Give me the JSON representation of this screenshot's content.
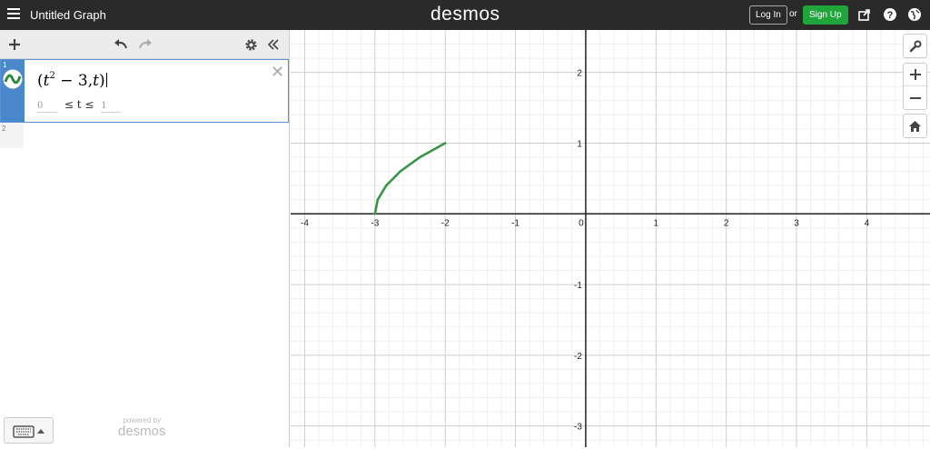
{
  "app": {
    "title": "Untitled Graph",
    "brand": "desmos",
    "login": "Log In",
    "or": "or",
    "signup": "Sign Up",
    "icons": [
      "menu-icon",
      "share-icon",
      "help-icon",
      "globe-icon"
    ]
  },
  "expressions": {
    "toolbar_icons": [
      "add-icon",
      "undo-icon",
      "redo-icon",
      "settings-icon",
      "collapse-icon"
    ],
    "items": [
      {
        "number": "1",
        "base": "t",
        "exponent": "2",
        "rest": " − 3,",
        "param": "t",
        "domain_min": "0",
        "domain_mid": "≤ t ≤",
        "domain_max": "1",
        "color": "#2d8b3a"
      },
      {
        "number": "2"
      }
    ]
  },
  "footer": {
    "powered_by": "powered by",
    "brand": "desmos"
  },
  "graph": {
    "x_ticks": [
      "-4",
      "-3",
      "-2",
      "-1",
      "0",
      "1",
      "2",
      "3",
      "4"
    ],
    "y_ticks": [
      "2",
      "1",
      "-1",
      "-2",
      "-3"
    ],
    "curve_color": "#3a9447",
    "tools": [
      "wrench-icon",
      "zoom-in-icon",
      "zoom-out-icon",
      "home-icon"
    ]
  },
  "chart_data": {
    "type": "line",
    "series": [
      {
        "x": [
          -3,
          -2.96,
          -2.84,
          -2.64,
          -2.36,
          -2
        ],
        "y": [
          0,
          0.2,
          0.4,
          0.6,
          0.8,
          1.0
        ]
      }
    ],
    "xlim": [
      -4.2,
      4.9
    ],
    "ylim": [
      -3.3,
      2.6
    ],
    "grid": true
  }
}
